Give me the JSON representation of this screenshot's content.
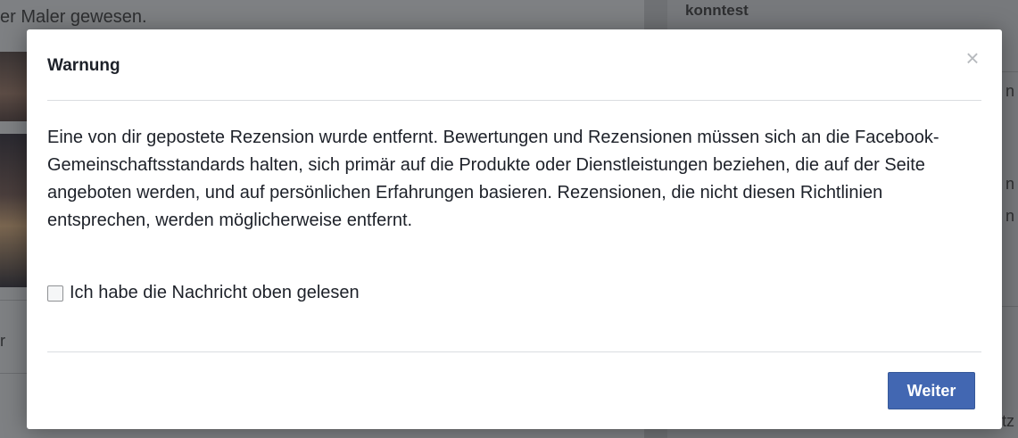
{
  "background": {
    "left_text": "er Maler gewesen.",
    "left_fragment": "r",
    "right_heading": "konntest",
    "right_fragments": [
      "n",
      "n",
      "n",
      "tz"
    ]
  },
  "dialog": {
    "title": "Warnung",
    "close_icon": "close-icon",
    "close_glyph": "×",
    "message": "Eine von dir gepostete Rezension wurde entfernt. Bewertungen und Rezensionen müssen sich an die Facebook-Gemeinschaftsstandards halten, sich primär auf die Produkte oder Dienstleistungen beziehen, die auf der Seite angeboten werden, und auf persönlichen Erfahrungen basieren. Rezensionen, die nicht diesen Richtlinien entsprechen, werden möglicherweise entfernt.",
    "checkbox_label": "Ich habe die Nachricht oben gelesen",
    "checkbox_checked": false,
    "continue_label": "Weiter"
  },
  "colors": {
    "primary_button": "#4267b2",
    "overlay": "#7b7d80",
    "text": "#1d2129"
  }
}
